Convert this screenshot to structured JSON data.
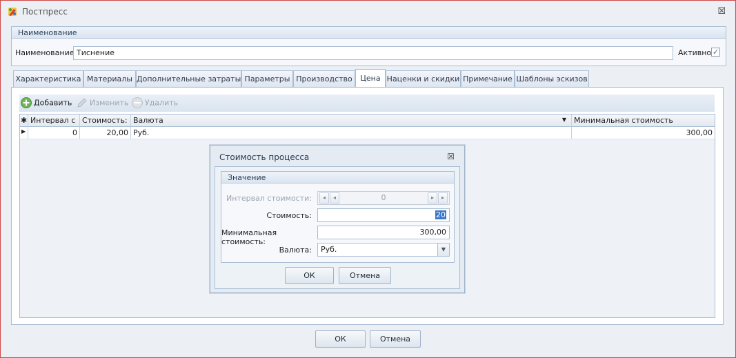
{
  "window": {
    "title": "Постпресс",
    "close_glyph": "☒"
  },
  "name_group": {
    "header": "Наименование",
    "name_label": "Наименование:",
    "name_value": "Тиснение",
    "active_label": "Активно",
    "active_checked": true
  },
  "tabs": [
    {
      "label": "Характеристика"
    },
    {
      "label": "Материалы"
    },
    {
      "label": "Дополнительные затраты"
    },
    {
      "label": "Параметры"
    },
    {
      "label": "Производство"
    },
    {
      "label": "Цена",
      "active": true
    },
    {
      "label": "Наценки и скидки"
    },
    {
      "label": "Примечание"
    },
    {
      "label": "Шаблоны эскизов"
    }
  ],
  "toolbar": {
    "add_label": "Добавить",
    "edit_label": "Изменить",
    "delete_label": "Удалить"
  },
  "grid": {
    "row_indicator_header": "✱",
    "columns": [
      "Интервал с",
      "Стоимость:",
      "Валюта",
      "Минимальная стоимость"
    ],
    "rows": [
      {
        "interval": "0",
        "cost": "20,00",
        "currency": "Руб.",
        "min_cost": "300,00"
      }
    ]
  },
  "dialog": {
    "title": "Стоимость процесса",
    "group_header": "Значение",
    "interval_label": "Интервал стоимости:",
    "interval_value": "0",
    "cost_label": "Стоимость:",
    "cost_value": "20",
    "min_cost_label": "Минимальная стоимость:",
    "min_cost_value": "300,00",
    "currency_label": "Валюта:",
    "currency_value": "Руб.",
    "ok_label": "ОК",
    "cancel_label": "Отмена"
  },
  "footer": {
    "ok_label": "ОК",
    "cancel_label": "Отмена"
  }
}
